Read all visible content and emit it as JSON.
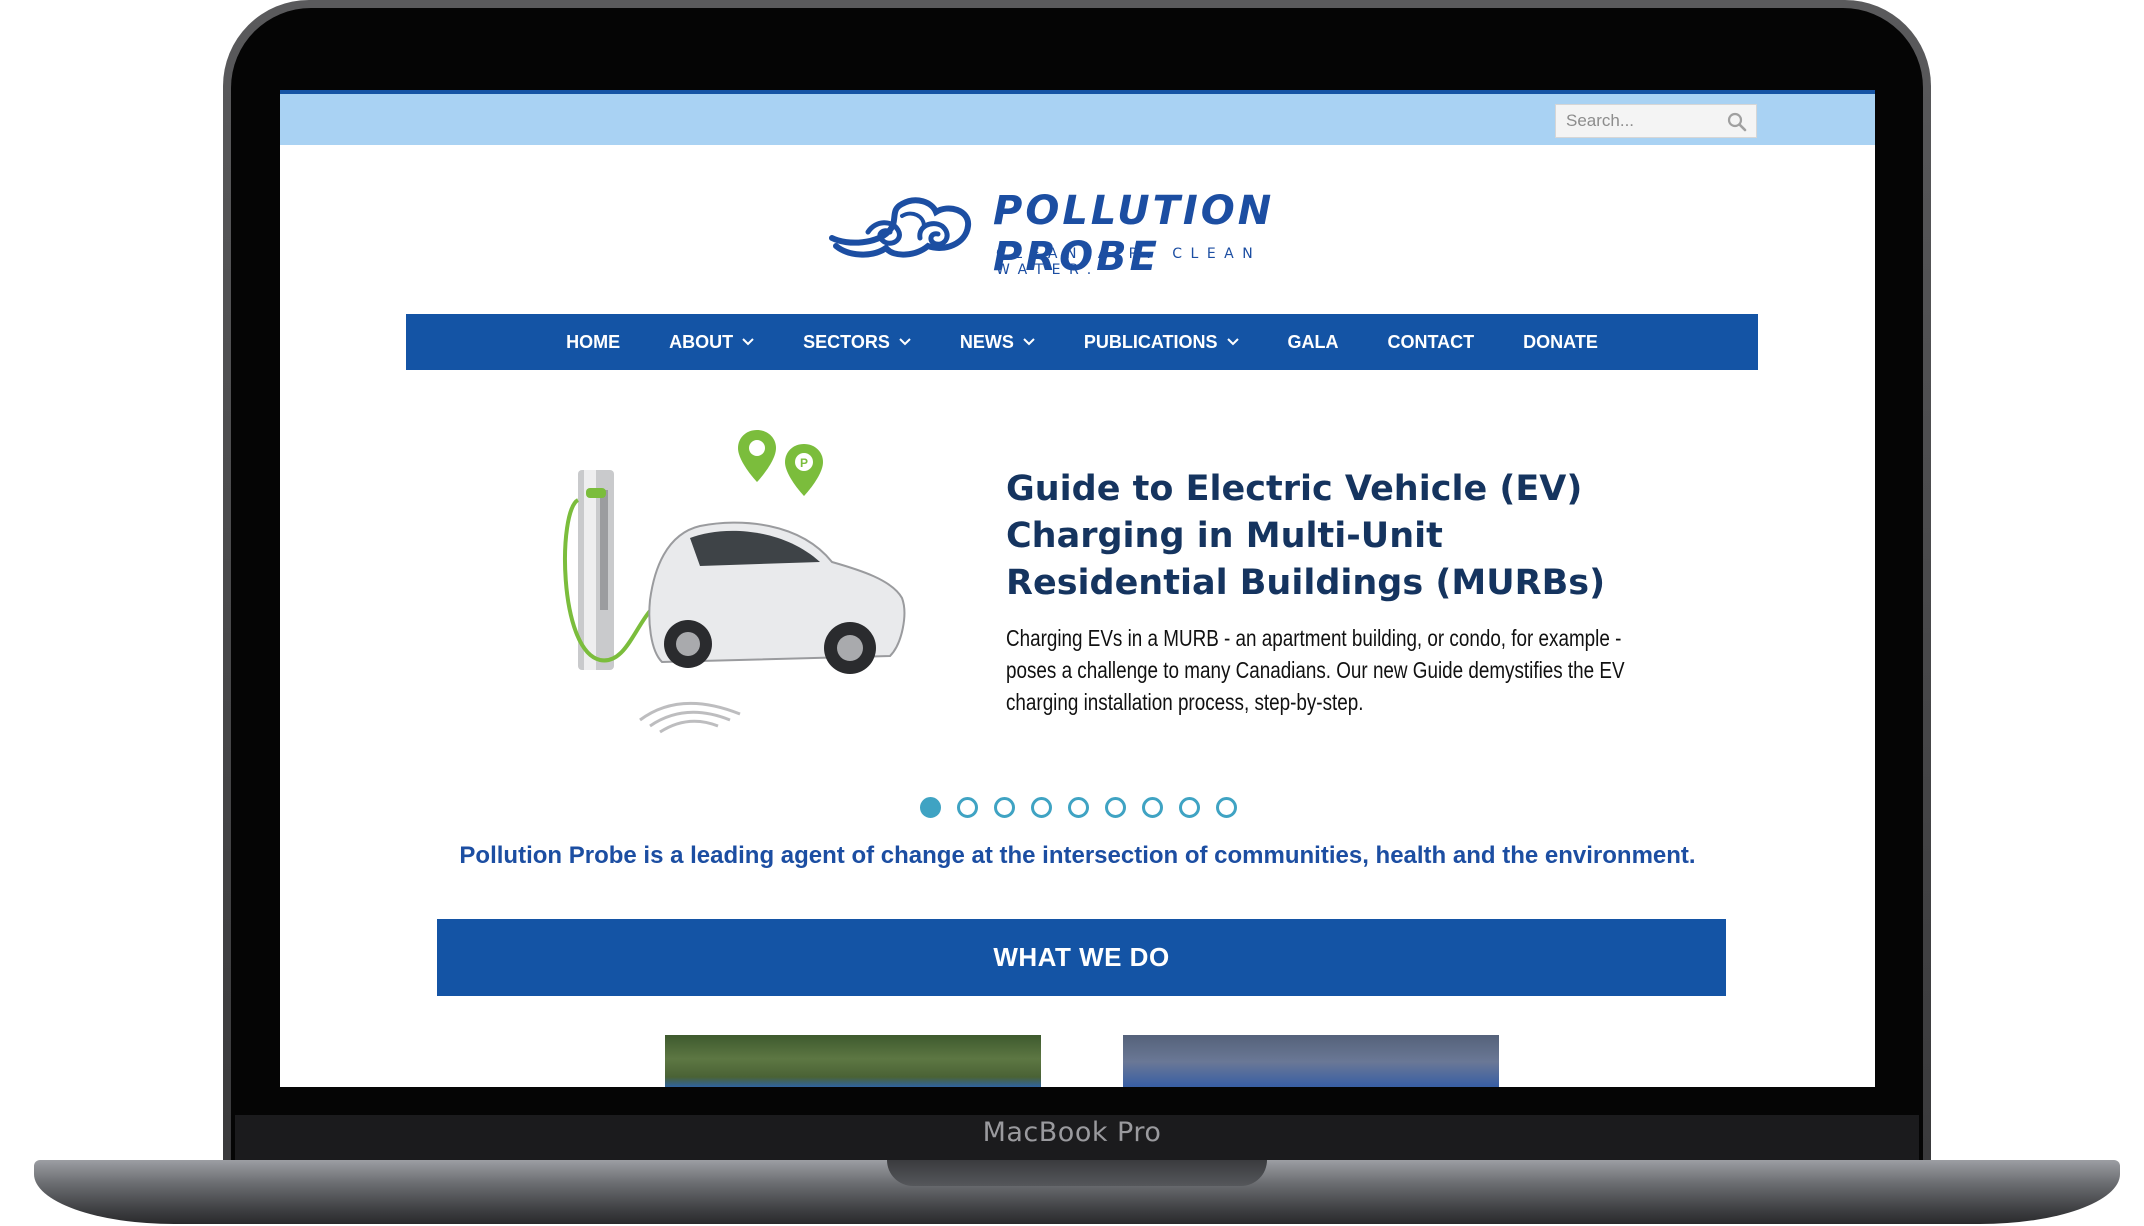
{
  "device": {
    "label": "MacBook Pro"
  },
  "search": {
    "placeholder": "Search..."
  },
  "logo": {
    "name": "POLLUTION PROBE",
    "tagline": "CLEAN AIR. CLEAN WATER."
  },
  "nav": {
    "items": [
      {
        "label": "HOME",
        "dropdown": false
      },
      {
        "label": "ABOUT",
        "dropdown": true
      },
      {
        "label": "SECTORS",
        "dropdown": true
      },
      {
        "label": "NEWS",
        "dropdown": true
      },
      {
        "label": "PUBLICATIONS",
        "dropdown": true
      },
      {
        "label": "GALA",
        "dropdown": false
      },
      {
        "label": "CONTACT",
        "dropdown": false
      },
      {
        "label": "DONATE",
        "dropdown": false
      }
    ]
  },
  "slide": {
    "title": "Guide to Electric Vehicle (EV) Charging in Multi-Unit Residential Buildings (MURBs)",
    "body": "Charging EVs in a MURB - an apartment building, or condo, for example - poses a challenge to many Canadians. Our new Guide demystifies the EV charging installation process, step-by-step.",
    "total": 9,
    "active": 1
  },
  "tagline": "Pollution Probe is a leading agent of change at the intersection of communities, health and the environment.",
  "section": {
    "title": "WHAT WE DO"
  },
  "colors": {
    "brand_blue": "#1454a5",
    "top_bar": "#a9d2f3",
    "dot": "#3fa3c3",
    "title_navy": "#15345f"
  }
}
